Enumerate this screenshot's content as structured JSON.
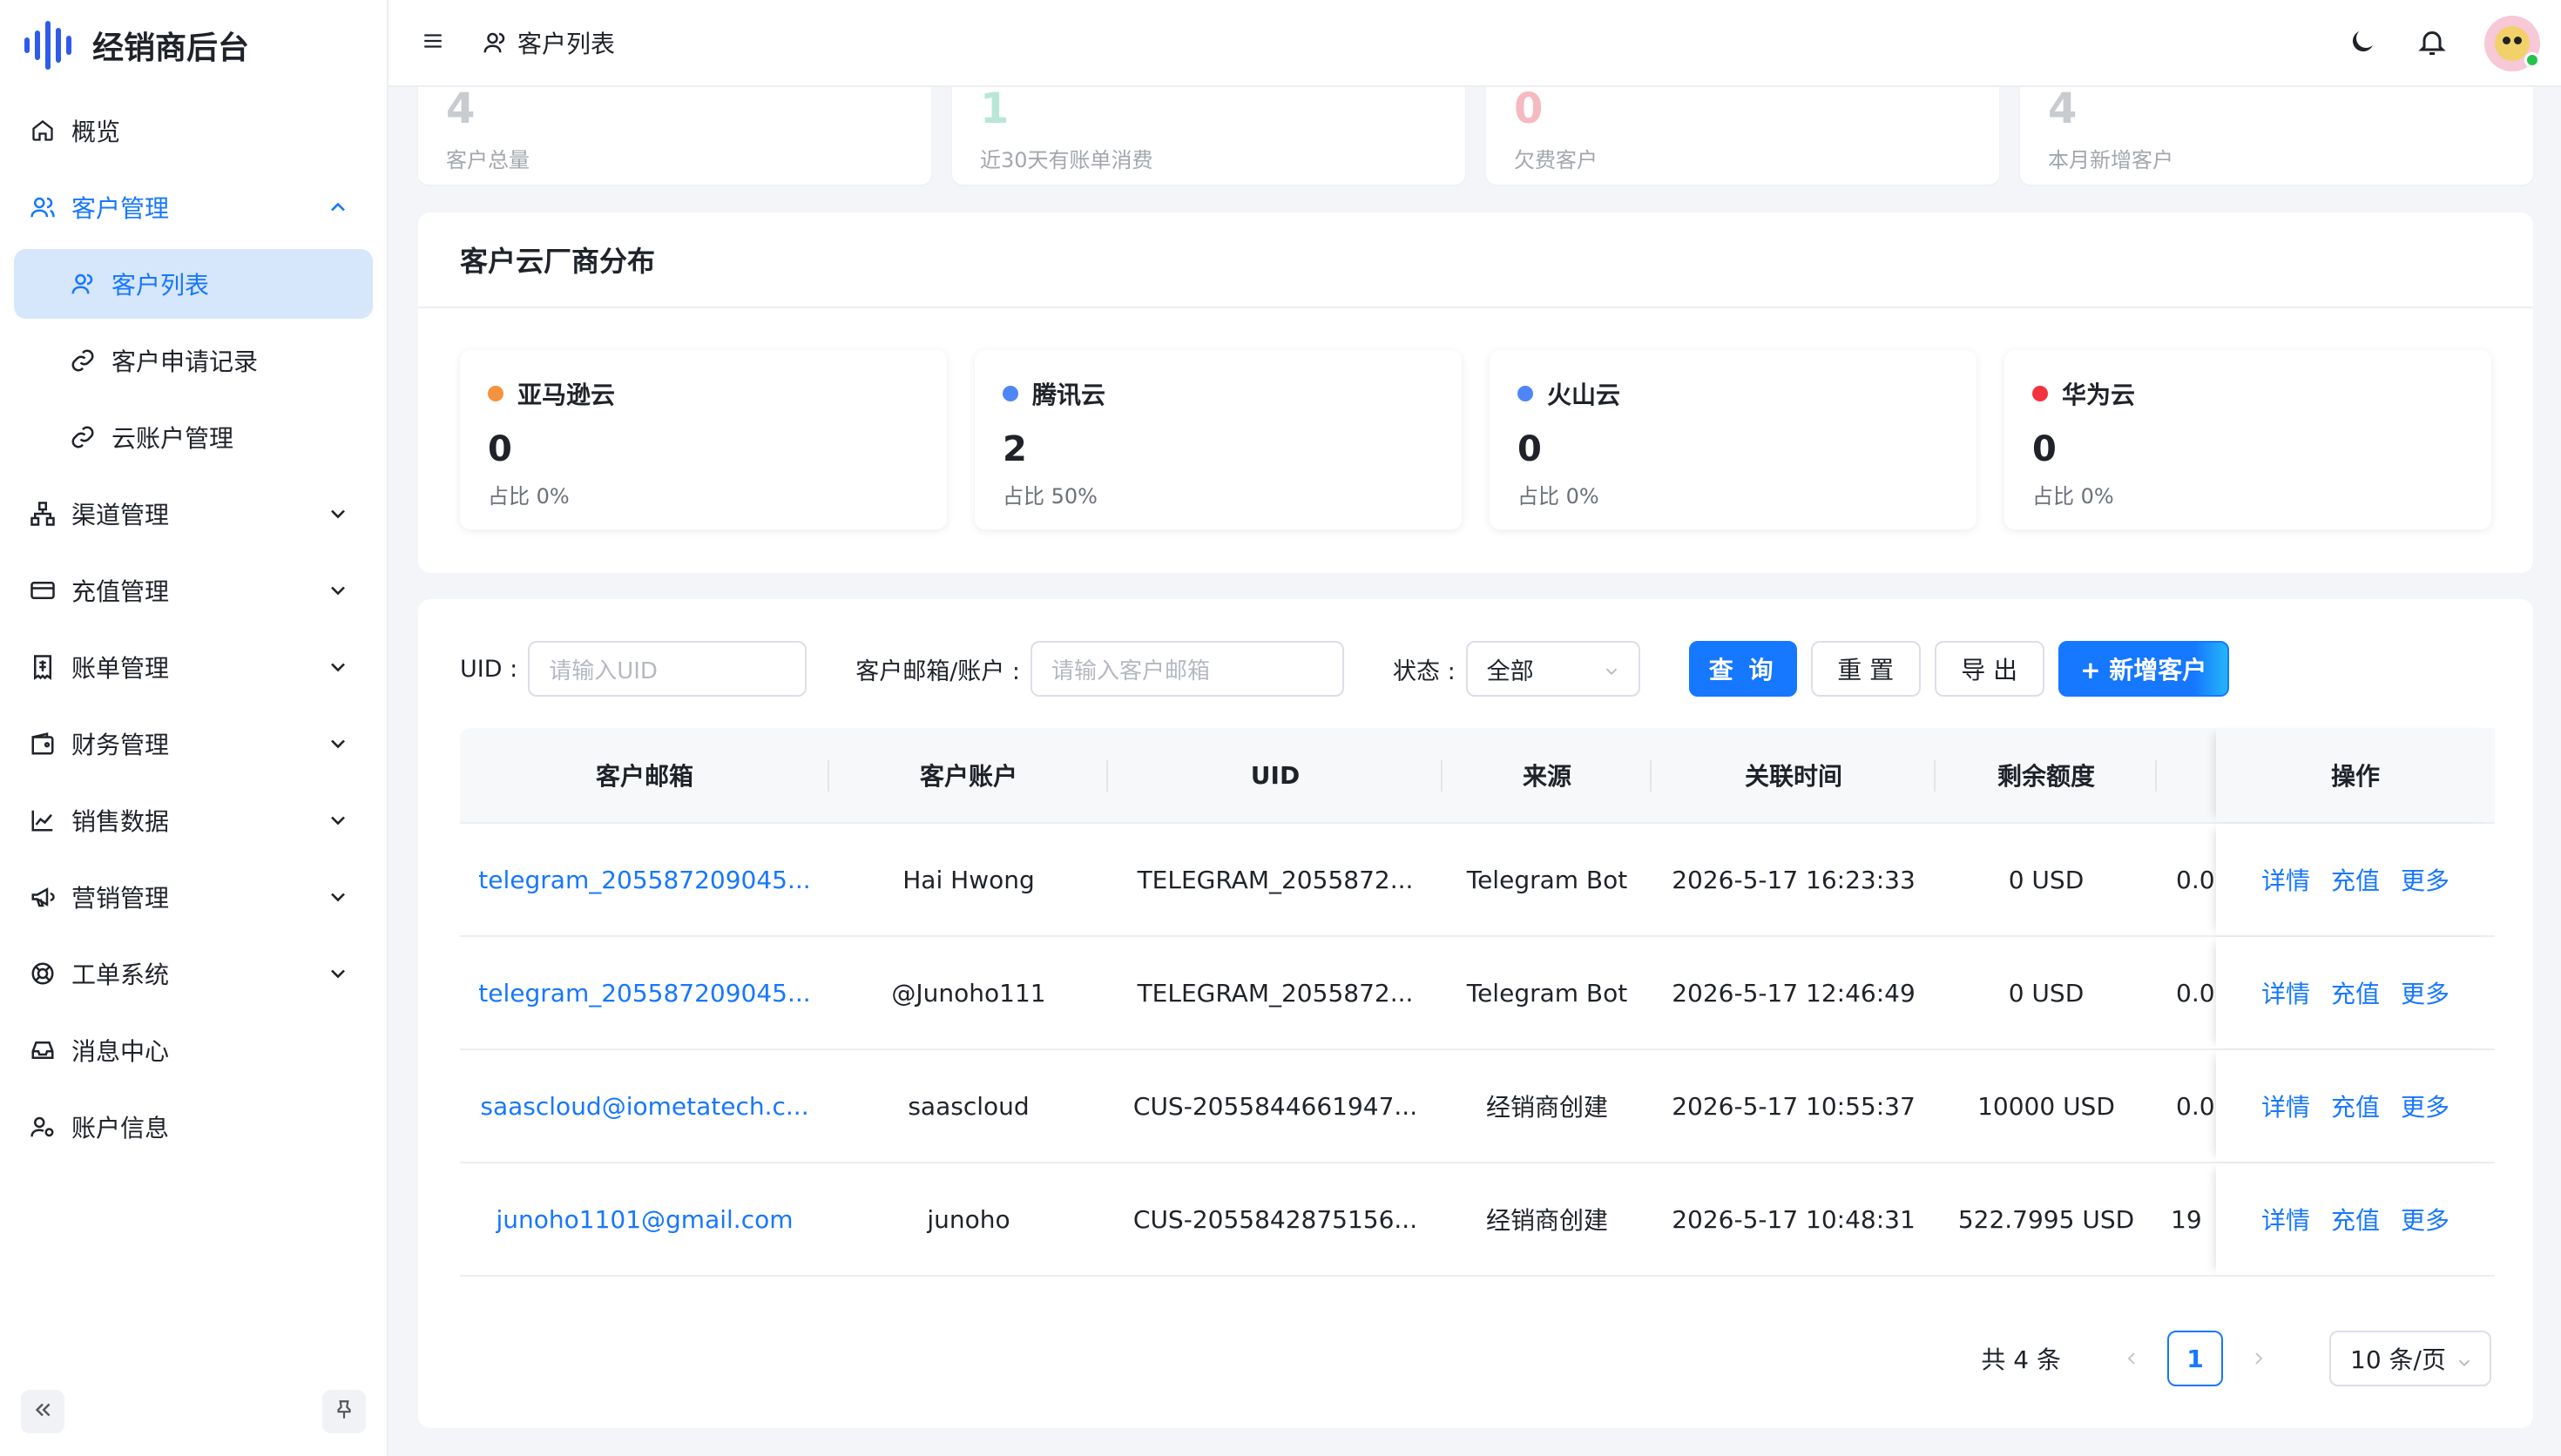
{
  "app": {
    "title": "经销商后台"
  },
  "sidebar": {
    "items": [
      {
        "label": "概览",
        "icon": "home-icon"
      },
      {
        "label": "客户管理",
        "icon": "users-icon",
        "open": true,
        "children": [
          {
            "label": "客户列表",
            "icon": "user-icon",
            "active": true
          },
          {
            "label": "客户申请记录",
            "icon": "link-icon"
          },
          {
            "label": "云账户管理",
            "icon": "link-icon"
          }
        ]
      },
      {
        "label": "渠道管理",
        "icon": "sitemap-icon"
      },
      {
        "label": "充值管理",
        "icon": "card-icon"
      },
      {
        "label": "账单管理",
        "icon": "receipt-icon"
      },
      {
        "label": "财务管理",
        "icon": "wallet-icon"
      },
      {
        "label": "销售数据",
        "icon": "chart-line-icon"
      },
      {
        "label": "营销管理",
        "icon": "megaphone-icon"
      },
      {
        "label": "工单系统",
        "icon": "lifebuoy-icon"
      },
      {
        "label": "消息中心",
        "icon": "inbox-icon"
      },
      {
        "label": "账户信息",
        "icon": "user-settings-icon"
      }
    ]
  },
  "header": {
    "breadcrumb": "客户列表"
  },
  "stats": [
    {
      "value": "4",
      "label": "客户总量",
      "color": "#c8cbd0"
    },
    {
      "value": "1",
      "label": "近30天有账单消费",
      "color": "#b9e6d7"
    },
    {
      "value": "0",
      "label": "欠费客户",
      "color": "#f5b9bf"
    },
    {
      "value": "4",
      "label": "本月新增客户",
      "color": "#c8cbd0"
    }
  ],
  "distribution": {
    "title": "客户云厂商分布",
    "cards": [
      {
        "name": "亚马逊云",
        "value": "0",
        "pct": "占比 0%",
        "color": "#f5923e"
      },
      {
        "name": "腾讯云",
        "value": "2",
        "pct": "占比 50%",
        "color": "#4f86f7"
      },
      {
        "name": "火山云",
        "value": "0",
        "pct": "占比 0%",
        "color": "#4f86f7"
      },
      {
        "name": "华为云",
        "value": "0",
        "pct": "占比 0%",
        "color": "#f2343e"
      }
    ]
  },
  "filters": {
    "uid_label": "UID :",
    "uid_placeholder": "请输入UID",
    "email_label": "客户邮箱/账户 :",
    "email_placeholder": "请输入客户邮箱",
    "status_label": "状态 :",
    "status_value": "全部",
    "query": "查 询",
    "reset": "重 置",
    "export": "导 出",
    "add": "+ 新增客户"
  },
  "table": {
    "columns": [
      "客户邮箱",
      "客户账户",
      "UID",
      "来源",
      "关联时间",
      "剩余额度",
      "",
      "操作"
    ],
    "rows": [
      {
        "email": "telegram_205587209045...",
        "account": "Hai Hwong",
        "uid": "TELEGRAM_2055872...",
        "source": "Telegram Bot",
        "time": "2026-5-17 16:23:33",
        "balance": "0 USD",
        "extra": "0.0"
      },
      {
        "email": "telegram_205587209045...",
        "account": "@Junoho111",
        "uid": "TELEGRAM_2055872...",
        "source": "Telegram Bot",
        "time": "2026-5-17 12:46:49",
        "balance": "0 USD",
        "extra": "0.0"
      },
      {
        "email": "saascloud@iometatech.c...",
        "account": "saascloud",
        "uid": "CUS-2055844661947...",
        "source": "经销商创建",
        "time": "2026-5-17 10:55:37",
        "balance": "10000 USD",
        "extra": "0.0"
      },
      {
        "email": "junoho1101@gmail.com",
        "account": "junoho",
        "uid": "CUS-2055842875156...",
        "source": "经销商创建",
        "time": "2026-5-17 10:48:31",
        "balance": "522.7995 USD",
        "extra": "19"
      }
    ],
    "ops": [
      "详情",
      "充值",
      "更多"
    ]
  },
  "pagination": {
    "total": "共 4 条",
    "page": "1",
    "size": "10 条/页"
  },
  "colors": {
    "primary": "#1677ff",
    "brand": "#2f5bea"
  }
}
